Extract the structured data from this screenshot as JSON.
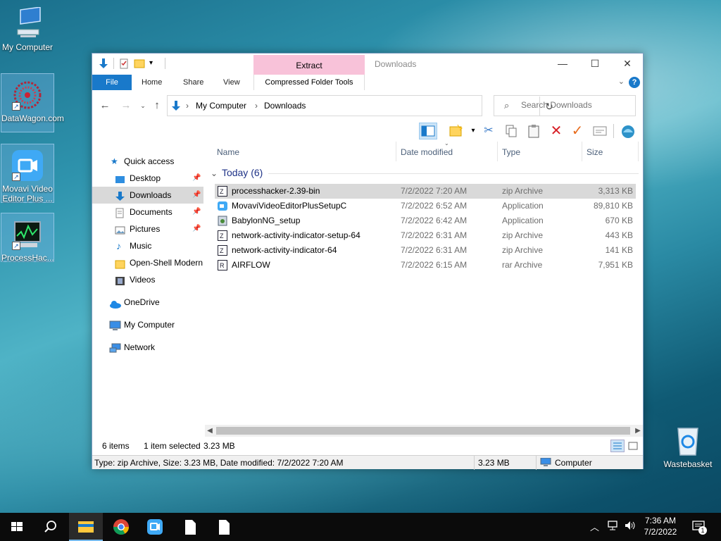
{
  "desktop": {
    "icons": [
      {
        "label": "My Computer"
      },
      {
        "label": "DataWagon.com"
      },
      {
        "label": "Movavi Video Editor Plus ..."
      },
      {
        "label": "ProcessHac..."
      }
    ],
    "wastebasket": "Wastebasket"
  },
  "window": {
    "title": "Downloads",
    "extract_tab": "Extract",
    "ribbon_tabs": {
      "file": "File",
      "home": "Home",
      "share": "Share",
      "view": "View",
      "compressed": "Compressed Folder Tools"
    },
    "help": "?",
    "breadcrumb": [
      "My Computer",
      "Downloads"
    ],
    "search_placeholder": "Search Downloads"
  },
  "sidebar": {
    "quick_access": "Quick access",
    "items": [
      {
        "label": "Desktop",
        "pinned": true
      },
      {
        "label": "Downloads",
        "pinned": true,
        "selected": true
      },
      {
        "label": "Documents",
        "pinned": true
      },
      {
        "label": "Pictures",
        "pinned": true
      },
      {
        "label": "Music",
        "pinned": false
      },
      {
        "label": "Open-Shell Modern",
        "pinned": false
      },
      {
        "label": "Videos",
        "pinned": false
      }
    ],
    "onedrive": "OneDrive",
    "my_computer": "My Computer",
    "network": "Network"
  },
  "columns": {
    "name": "Name",
    "date": "Date modified",
    "type": "Type",
    "size": "Size"
  },
  "group": {
    "label": "Today (6)"
  },
  "files": [
    {
      "name": "processhacker-2.39-bin",
      "date": "7/2/2022 7:20 AM",
      "type": "zip Archive",
      "size": "3,313 KB",
      "icon": "zip-icon",
      "selected": true
    },
    {
      "name": "MovaviVideoEditorPlusSetupC",
      "date": "7/2/2022 6:52 AM",
      "type": "Application",
      "size": "89,810 KB",
      "icon": "movavi-icon",
      "selected": false
    },
    {
      "name": "BabylonNG_setup",
      "date": "7/2/2022 6:42 AM",
      "type": "Application",
      "size": "670 KB",
      "icon": "installer-icon",
      "selected": false
    },
    {
      "name": "network-activity-indicator-setup-64",
      "date": "7/2/2022 6:31 AM",
      "type": "zip Archive",
      "size": "443 KB",
      "icon": "zip-icon",
      "selected": false
    },
    {
      "name": "network-activity-indicator-64",
      "date": "7/2/2022 6:31 AM",
      "type": "zip Archive",
      "size": "141 KB",
      "icon": "zip-icon",
      "selected": false
    },
    {
      "name": "AIRFLOW",
      "date": "7/2/2022 6:15 AM",
      "type": "rar Archive",
      "size": "7,951 KB",
      "icon": "rar-icon",
      "selected": false
    }
  ],
  "status": {
    "items": "6 items",
    "selected": "1 item selected",
    "size": "3.23 MB"
  },
  "details": {
    "info": "Type: zip Archive, Size: 3.23 MB, Date modified: 7/2/2022 7:20 AM",
    "size": "3.23 MB",
    "location": "Computer"
  },
  "taskbar": {
    "time": "7:36 AM",
    "date": "7/2/2022",
    "notifications": "1"
  }
}
